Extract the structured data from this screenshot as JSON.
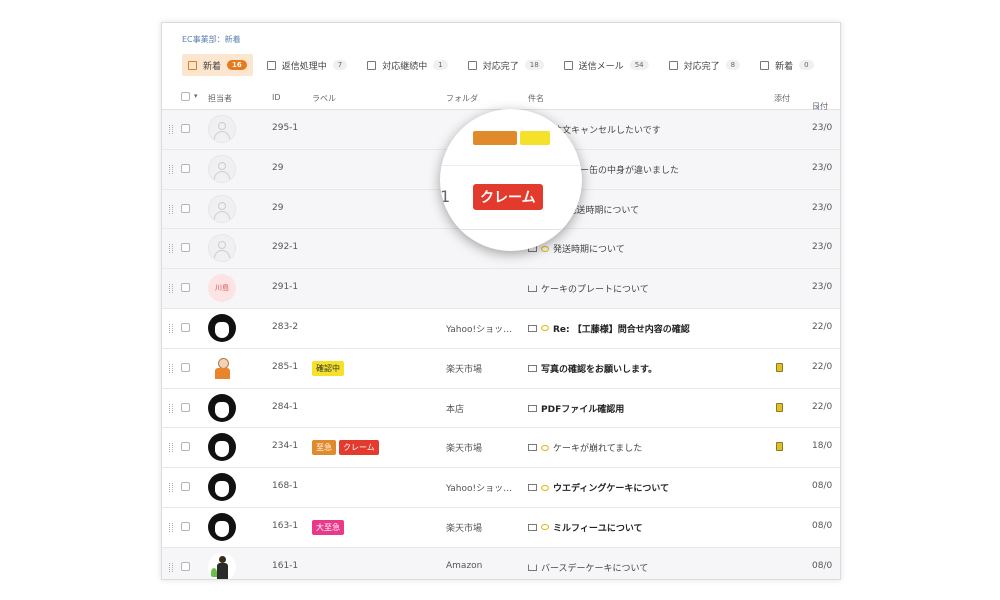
{
  "breadcrumb": "EC事業部：新着",
  "tabs": [
    {
      "label": "新着",
      "count": "16",
      "active": true
    },
    {
      "label": "返信処理中",
      "count": "7"
    },
    {
      "label": "対応継続中",
      "count": "1"
    },
    {
      "label": "対応完了",
      "count": "18"
    },
    {
      "label": "送信メール",
      "count": "54"
    },
    {
      "label": "対応完了",
      "count": "8"
    },
    {
      "label": "新着",
      "count": "0"
    }
  ],
  "header": {
    "assignee": "担当者",
    "id": "ID",
    "label": "ラベル",
    "folder": "フォルダ",
    "subject": "件名",
    "attachment": "添付",
    "date": "日付"
  },
  "colors": {
    "accent": "#e87a1e",
    "claim_red": "#e23b2e",
    "confirm_yellow": "#f5e12a",
    "urgent_orange": "#e08a2b",
    "top_urgent_pink": "#e8398a"
  },
  "rows": [
    {
      "id": "295-1",
      "avatar": "default",
      "folder": "",
      "subject": "注文キャンセルしたいです",
      "bold": false,
      "date": "23/0",
      "labels": []
    },
    {
      "id": "29",
      "avatar": "default",
      "folder": "",
      "subject": "クッキー缶の中身が違いました",
      "bold": false,
      "date": "23/0",
      "labels": []
    },
    {
      "id": "29",
      "avatar": "default",
      "folder": "",
      "subject": "Re:発送時期について",
      "bold": false,
      "date": "23/0",
      "labels": []
    },
    {
      "id": "292-1",
      "avatar": "default",
      "folder": "",
      "subject": "発送時期について",
      "bold": false,
      "date": "23/0",
      "labels": []
    },
    {
      "id": "291-1",
      "avatar": "text",
      "avatar_text": "川島",
      "folder": "",
      "subject": "ケーキのプレートについて",
      "bold": false,
      "date": "23/0",
      "labels": []
    },
    {
      "id": "283-2",
      "avatar": "face",
      "folder": "Yahoo!ショッ…",
      "subject": "Re: 【工藤様】問合せ内容の確認",
      "bold": true,
      "date": "22/0",
      "labels": []
    },
    {
      "id": "285-1",
      "avatar": "worker",
      "folder": "楽天市場",
      "subject": "写真の確認をお願いします。",
      "bold": true,
      "date": "22/0",
      "labels": [
        {
          "text": "確認中",
          "bg": "#f5e12a",
          "fg": "#333"
        }
      ],
      "attach": true
    },
    {
      "id": "284-1",
      "avatar": "face",
      "folder": "本店",
      "subject": "PDFファイル確認用",
      "bold": true,
      "date": "22/0",
      "labels": [],
      "attach": true
    },
    {
      "id": "234-1",
      "avatar": "face",
      "folder": "楽天市場",
      "subject": "ケーキが崩れてました",
      "bold": false,
      "date": "18/0",
      "labels": [
        {
          "text": "至急",
          "bg": "#e08a2b",
          "fg": "#fff"
        },
        {
          "text": "クレーム",
          "bg": "#e23b2e",
          "fg": "#fff"
        }
      ],
      "attach": true
    },
    {
      "id": "168-1",
      "avatar": "face",
      "folder": "Yahoo!ショッ…",
      "subject": "ウエディングケーキについて",
      "bold": true,
      "date": "08/0",
      "labels": []
    },
    {
      "id": "163-1",
      "avatar": "face",
      "folder": "楽天市場",
      "subject": "ミルフィーユについて",
      "bold": true,
      "date": "08/0",
      "labels": [
        {
          "text": "大至急",
          "bg": "#e8398a",
          "fg": "#fff"
        }
      ]
    },
    {
      "id": "161-1",
      "avatar": "person",
      "folder": "Amazon",
      "subject": "バースデーケーキについて",
      "bold": false,
      "date": "08/0",
      "labels": []
    }
  ],
  "magnifier": {
    "id_fragment": "1",
    "label": "クレーム"
  }
}
